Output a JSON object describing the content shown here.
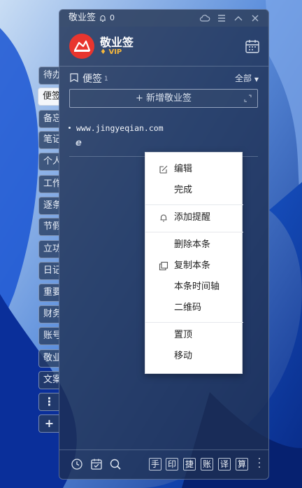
{
  "app": {
    "title": "敬业签",
    "reminder_count": "0",
    "name": "敬业签",
    "vip_label": "VIP",
    "brand_color": "#e8352e"
  },
  "side_tabs": [
    {
      "label": "待办",
      "active": false
    },
    {
      "label": "便签",
      "active": true
    },
    {
      "label": "备忘",
      "active": false
    },
    {
      "label": "笔记",
      "active": false
    },
    {
      "label": "个人",
      "active": false
    },
    {
      "label": "工作",
      "active": false
    },
    {
      "label": "逐条",
      "active": false
    },
    {
      "label": "节假",
      "active": false
    },
    {
      "label": "立功",
      "active": false
    },
    {
      "label": "日记",
      "active": false
    },
    {
      "label": "重要",
      "active": false
    },
    {
      "label": "财务",
      "active": false
    },
    {
      "label": "账号",
      "active": false
    },
    {
      "label": "敬业",
      "active": false
    },
    {
      "label": "文案",
      "active": false
    }
  ],
  "side_more": "⋮",
  "side_add": "+",
  "section": {
    "label": "便签",
    "count": "1",
    "filter": "全部"
  },
  "add_note_label": "+ 新增敬业签",
  "notes": [
    {
      "text": "www.jingyeqian.com",
      "icon": "ie-browser-icon"
    }
  ],
  "footer": {
    "icons": [
      "clock-icon",
      "check-calendar-icon",
      "search-icon"
    ],
    "keys": [
      "手",
      "印",
      "捷",
      "账",
      "译",
      "算"
    ]
  },
  "context_menu": [
    {
      "label": "编辑",
      "icon": "edit-icon"
    },
    {
      "label": "完成",
      "icon": ""
    },
    {
      "label": "添加提醒",
      "icon": "bell-icon"
    },
    {
      "label": "删除本条",
      "icon": ""
    },
    {
      "label": "复制本条",
      "icon": "copy-icon"
    },
    {
      "label": "本条时间轴",
      "icon": ""
    },
    {
      "label": "二维码",
      "icon": ""
    },
    {
      "label": "置顶",
      "icon": ""
    },
    {
      "label": "移动",
      "icon": ""
    }
  ]
}
